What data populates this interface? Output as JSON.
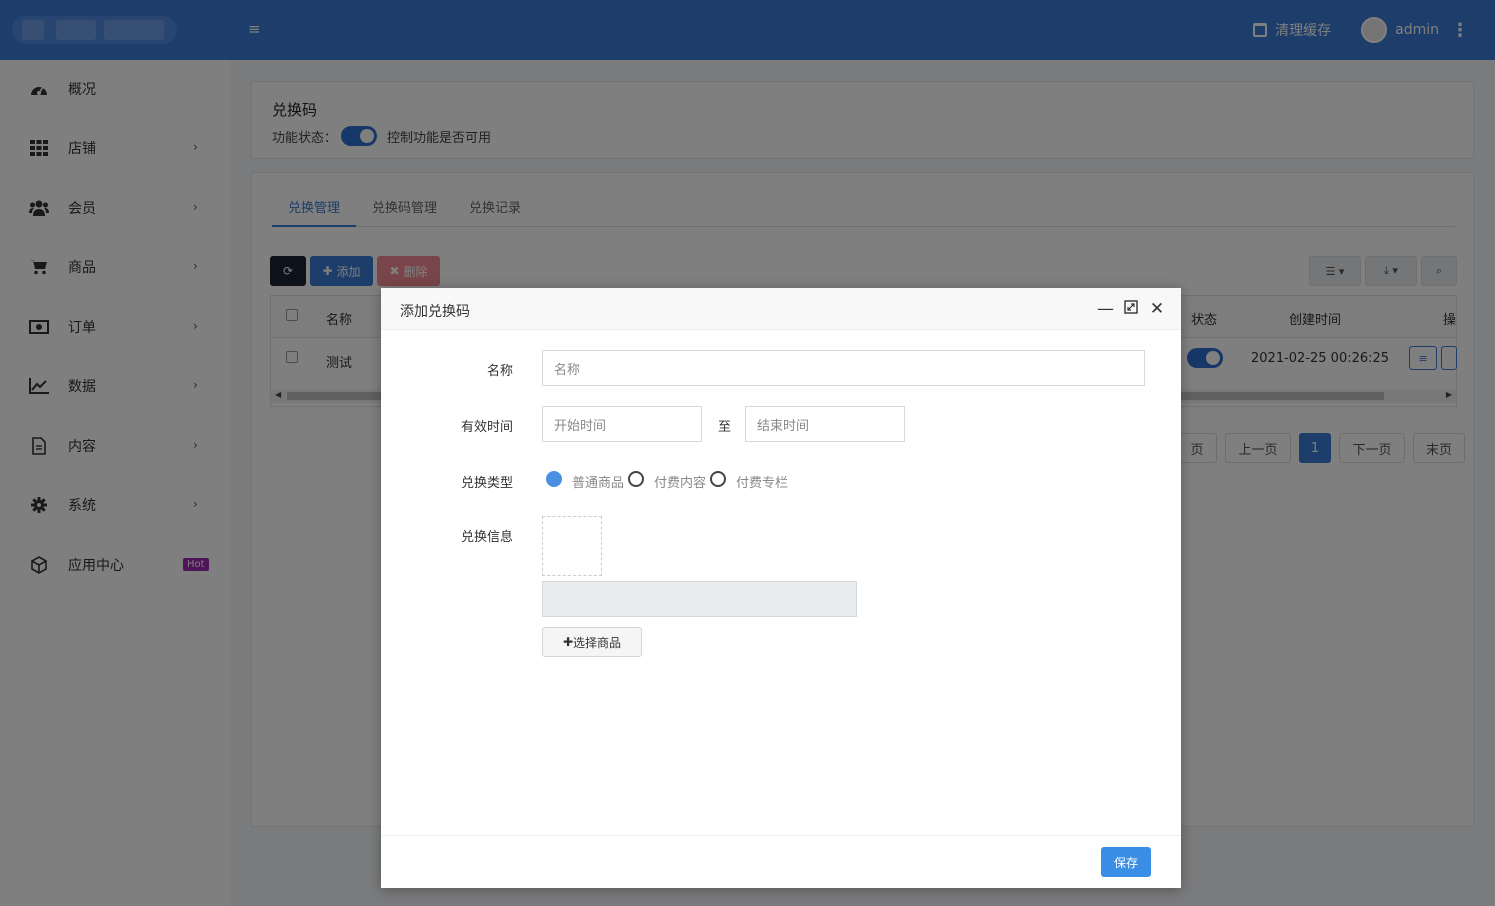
{
  "header": {
    "clear_cache": "清理缓存",
    "username": "admin"
  },
  "sidebar": {
    "items": [
      {
        "label": "概况",
        "icon": "dashboard-icon"
      },
      {
        "label": "店铺",
        "icon": "grid-icon"
      },
      {
        "label": "会员",
        "icon": "users-icon"
      },
      {
        "label": "商品",
        "icon": "cart-icon"
      },
      {
        "label": "订单",
        "icon": "money-icon"
      },
      {
        "label": "数据",
        "icon": "chart-line-icon"
      },
      {
        "label": "内容",
        "icon": "document-icon"
      },
      {
        "label": "系统",
        "icon": "gear-icon"
      },
      {
        "label": "应用中心",
        "icon": "cube-icon",
        "badge": "Hot"
      }
    ]
  },
  "feature": {
    "title": "兑换码",
    "status_label": "功能状态：",
    "status_desc": "控制功能是否可用",
    "enabled": true
  },
  "tabs": [
    "兑换管理",
    "兑换码管理",
    "兑换记录"
  ],
  "toolbar": {
    "add_label": "添加",
    "delete_label": "删除"
  },
  "table": {
    "headers": {
      "name": "名称",
      "status": "状态",
      "created": "创建时间",
      "ops": "操"
    },
    "rows": [
      {
        "name": "测试",
        "status": true,
        "created": "2021-02-25 00:26:25"
      }
    ]
  },
  "pager": {
    "partial": "页",
    "prev": "上一页",
    "current": "1",
    "next": "下一页",
    "last": "末页"
  },
  "modal": {
    "title": "添加兑换码",
    "name_label": "名称",
    "name_placeholder": "名称",
    "time_label": "有效时间",
    "start_placeholder": "开始时间",
    "to_label": "至",
    "end_placeholder": "结束时间",
    "type_label": "兑换类型",
    "type_options": [
      "普通商品",
      "付费内容",
      "付费专栏"
    ],
    "type_selected": "普通商品",
    "info_label": "兑换信息",
    "select_goods": "选择商品",
    "save": "保存"
  }
}
